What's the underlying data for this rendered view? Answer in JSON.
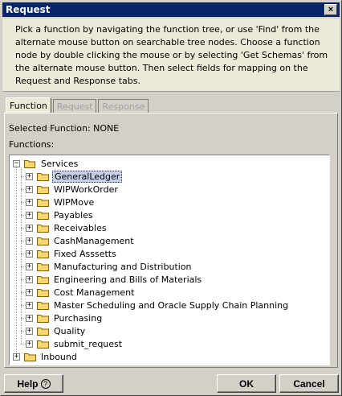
{
  "window": {
    "title": "Request",
    "close_symbol": "×"
  },
  "instructions": "Pick a function by navigating the function tree, or use 'Find' from the alternate mouse button on searchable tree nodes. Choose a function node by double clicking the mouse or by selecting 'Get Schemas' from the alternate mouse button. Then select fields for mapping on the Request and Response tabs.",
  "tabs": [
    {
      "label": "Function",
      "active": true
    },
    {
      "label": "Request",
      "active": false
    },
    {
      "label": "Response",
      "active": false
    }
  ],
  "selected_function": "Selected Function: NONE",
  "functions_label": "Functions:",
  "tree": {
    "root": {
      "label": "Services",
      "expanded": true
    },
    "children": [
      {
        "label": "GeneralLedger",
        "selected": true
      },
      {
        "label": "WIPWorkOrder"
      },
      {
        "label": "WIPMove"
      },
      {
        "label": "Payables"
      },
      {
        "label": "Receivables"
      },
      {
        "label": "CashManagement"
      },
      {
        "label": "Fixed Asssetts"
      },
      {
        "label": "Manufacturing and Distribution"
      },
      {
        "label": "Engineering and Bills of Materials"
      },
      {
        "label": "Cost Management"
      },
      {
        "label": "Master Scheduling and Oracle Supply Chain Planning"
      },
      {
        "label": "Purchasing"
      },
      {
        "label": "Quality"
      },
      {
        "label": "submit_request"
      }
    ],
    "second_root": {
      "label": "Inbound",
      "expanded": false
    },
    "expand_symbol": "+",
    "collapse_symbol": "−"
  },
  "buttons": {
    "help": "Help",
    "help_icon": "?",
    "ok": "OK",
    "cancel": "Cancel"
  },
  "colors": {
    "titlebar": "#0a246a",
    "selection": "#c8d0e8",
    "folder": "#f5d76e"
  }
}
